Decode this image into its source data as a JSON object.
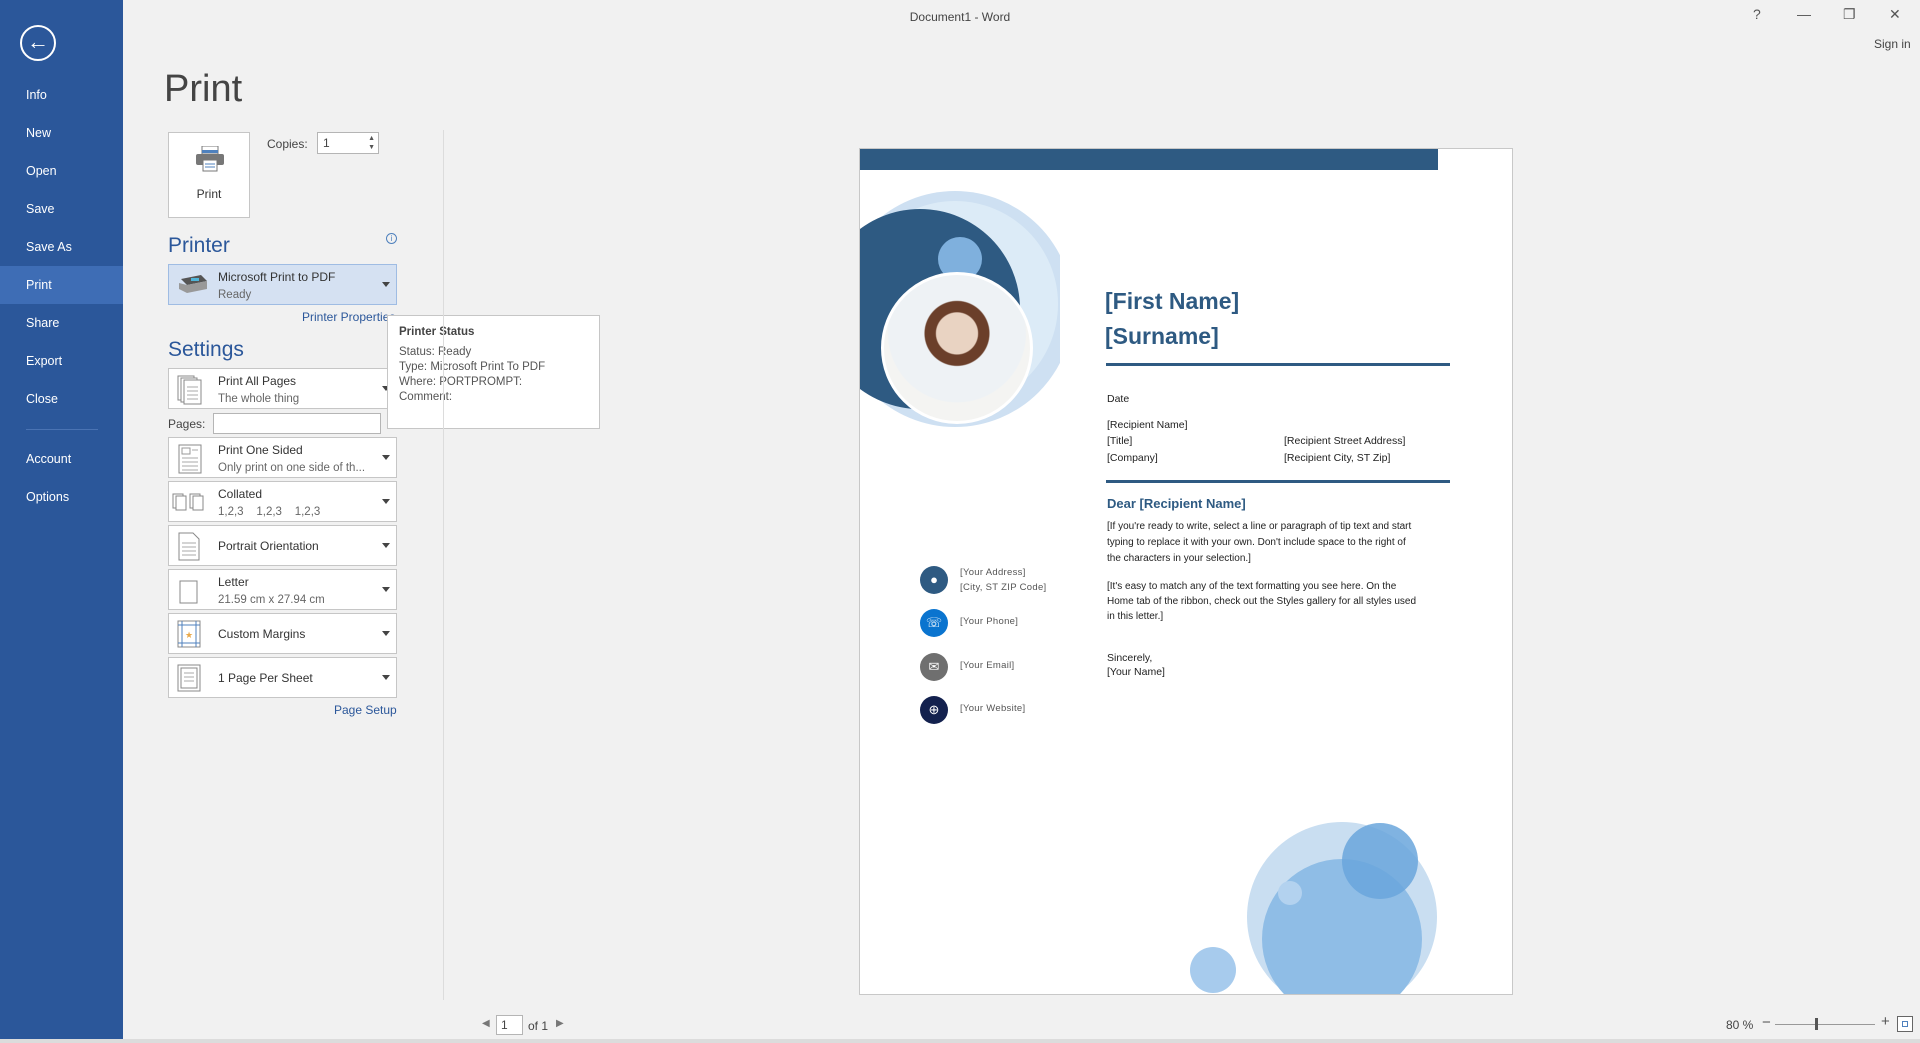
{
  "window": {
    "title": "Document1 - Word",
    "help": "?",
    "minimize": "—",
    "restore": "❐",
    "close": "✕",
    "sign_in": "Sign in"
  },
  "sidebar": {
    "back": "←",
    "items": [
      {
        "label": "Info"
      },
      {
        "label": "New"
      },
      {
        "label": "Open"
      },
      {
        "label": "Save"
      },
      {
        "label": "Save As"
      },
      {
        "label": "Print",
        "active": true
      },
      {
        "label": "Share"
      },
      {
        "label": "Export"
      },
      {
        "label": "Close"
      },
      {
        "label": "Account"
      },
      {
        "label": "Options"
      }
    ]
  },
  "print": {
    "heading": "Print",
    "button_label": "Print",
    "copies_label": "Copies:",
    "copies_value": "1"
  },
  "printer": {
    "heading": "Printer",
    "name": "Microsoft Print to PDF",
    "status": "Ready",
    "properties_link": "Printer Properties",
    "info": "i"
  },
  "tooltip": {
    "title": "Printer Status",
    "lines": [
      "Status: Ready",
      "Type: Microsoft Print To PDF",
      "Where: PORTPROMPT:",
      "Comment:"
    ]
  },
  "settings": {
    "heading": "Settings",
    "pages_label": "Pages:",
    "pages_value": "",
    "page_setup_link": "Page Setup",
    "options": [
      {
        "title": "Print All Pages",
        "subtitle": "The whole thing"
      },
      {
        "title": "Print One Sided",
        "subtitle": "Only print on one side of th..."
      },
      {
        "title": "Collated",
        "subtitle": "1,2,3    1,2,3    1,2,3"
      },
      {
        "title": "Portrait Orientation"
      },
      {
        "title": "Letter",
        "subtitle": "21.59 cm x 27.94 cm"
      },
      {
        "title": "Custom Margins"
      },
      {
        "title": "1 Page Per Sheet"
      }
    ]
  },
  "preview": {
    "first_name": "[First Name]",
    "surname": "[Surname]",
    "date": "Date",
    "recipient_name": "[Recipient Name]",
    "title": "[Title]",
    "company": "[Company]",
    "street": "[Recipient Street Address]",
    "city": "[Recipient City, ST Zip]",
    "greeting": "Dear [Recipient Name]",
    "para1": [
      "[If you're ready to write, select a line or paragraph of tip text and start",
      "typing to replace it with your own. Don't include space to the right of",
      "the characters in your selection.]"
    ],
    "para2": [
      "[It's easy to match any of the text formatting you see here. On the",
      "Home tab of the ribbon, check out the Styles gallery for all styles used",
      "in this letter.]"
    ],
    "closing": "Sincerely,",
    "your_name": "[Your Name]",
    "contacts": {
      "address": "[Your Address]",
      "city": "[City, ST ZIP Code]",
      "phone": "[Your Phone]",
      "email": "[Your Email]",
      "website": "[Your Website]"
    },
    "accent": "#2e5a82"
  },
  "footer": {
    "page_value": "1",
    "of_label": "of 1",
    "zoom": "80 %",
    "zoom_minus": "−",
    "zoom_plus": "+",
    "zoom_level_percent": 80
  }
}
